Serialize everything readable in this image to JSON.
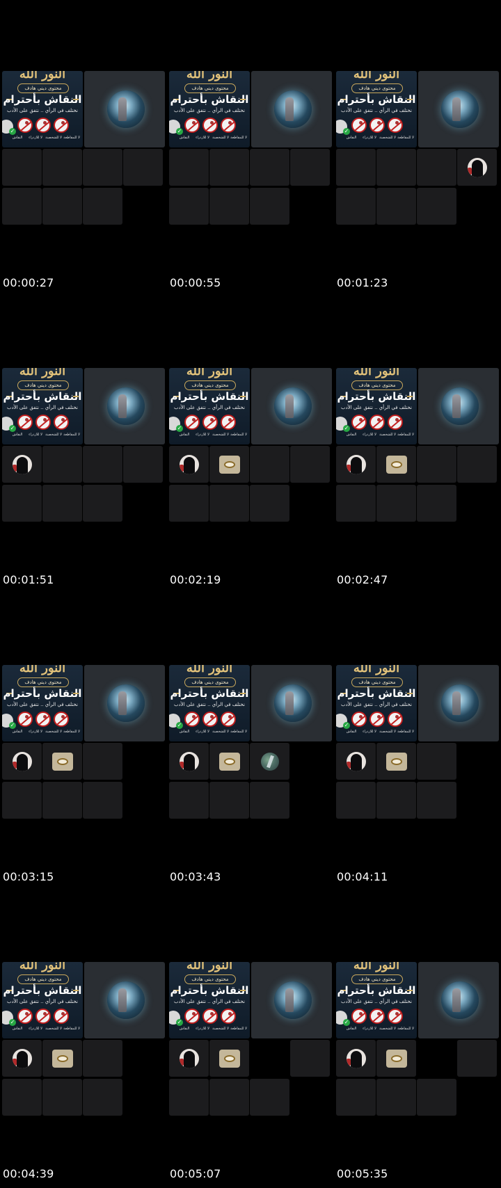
{
  "banner": {
    "logo_text": "النور الله",
    "pill": "محتوى ديني هادف",
    "title": "النقاش بأحترام",
    "subtitle": "نختلف في الرأي .. نتفق على الأدب",
    "rules_small": [
      "لا للمقاطعة",
      "لا للشخصنة",
      "لا للازدراء",
      "النقاش"
    ]
  },
  "frames": [
    {
      "timestamp": "00:00:27",
      "tiles": [
        null,
        null,
        null,
        null,
        null,
        null,
        null
      ]
    },
    {
      "timestamp": "00:00:55",
      "tiles": [
        null,
        null,
        null,
        null,
        null,
        null,
        null
      ]
    },
    {
      "timestamp": "00:01:23",
      "tiles": [
        null,
        null,
        null,
        "woman",
        null,
        null,
        null
      ]
    },
    {
      "timestamp": "00:01:51",
      "tiles": [
        "woman",
        null,
        null,
        null,
        null,
        null,
        null
      ]
    },
    {
      "timestamp": "00:02:19",
      "tiles": [
        "woman",
        "dish",
        null,
        null,
        null,
        null,
        null
      ]
    },
    {
      "timestamp": "00:02:47",
      "tiles": [
        "woman",
        "dish",
        null,
        null,
        null,
        null,
        null
      ]
    },
    {
      "timestamp": "00:03:15",
      "tiles": [
        "woman",
        "dish",
        null,
        "hidden",
        null,
        null,
        null
      ]
    },
    {
      "timestamp": "00:03:43",
      "tiles": [
        "woman",
        "dish",
        "nature",
        "hidden",
        null,
        null,
        null
      ]
    },
    {
      "timestamp": "00:04:11",
      "tiles": [
        "woman",
        "dish",
        null,
        "hidden",
        null,
        null,
        null
      ]
    },
    {
      "timestamp": "00:04:39",
      "tiles": [
        "woman",
        "dish",
        null,
        "hidden",
        null,
        null,
        null
      ]
    },
    {
      "timestamp": "00:05:07",
      "tiles": [
        "woman",
        "dish",
        "hidden",
        null,
        null,
        null,
        null
      ]
    },
    {
      "timestamp": "00:05:35",
      "tiles": [
        "woman",
        "dish",
        "hidden",
        null,
        null,
        null,
        null
      ]
    }
  ]
}
